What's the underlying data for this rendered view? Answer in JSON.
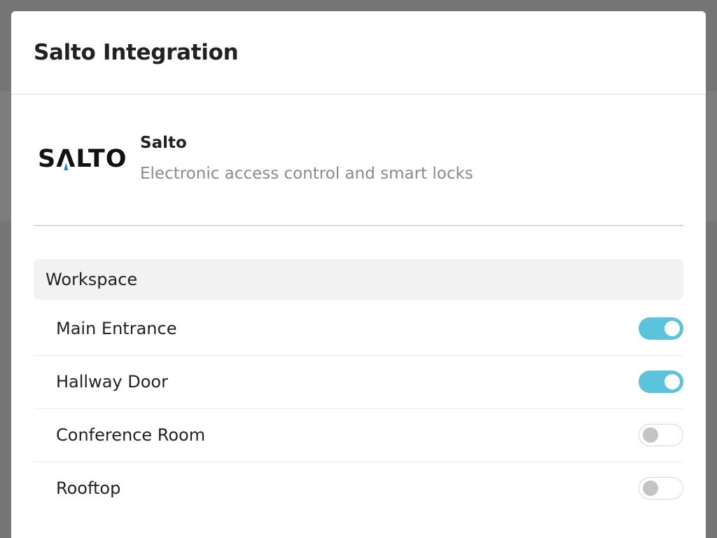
{
  "modal": {
    "title": "Salto Integration"
  },
  "provider": {
    "logo_text": "SALTO",
    "logo_accent_color": "#1e88e5",
    "name": "Salto",
    "description": "Electronic access control and smart locks"
  },
  "section": {
    "title": "Workspace"
  },
  "doors": [
    {
      "label": "Main Entrance",
      "enabled": true
    },
    {
      "label": "Hallway Door",
      "enabled": true
    },
    {
      "label": "Conference Room",
      "enabled": false
    },
    {
      "label": "Rooftop",
      "enabled": false
    }
  ],
  "colors": {
    "toggle_on": "#5bc4dc",
    "toggle_off_knob": "#c4c4c4",
    "backdrop": "#757575"
  }
}
